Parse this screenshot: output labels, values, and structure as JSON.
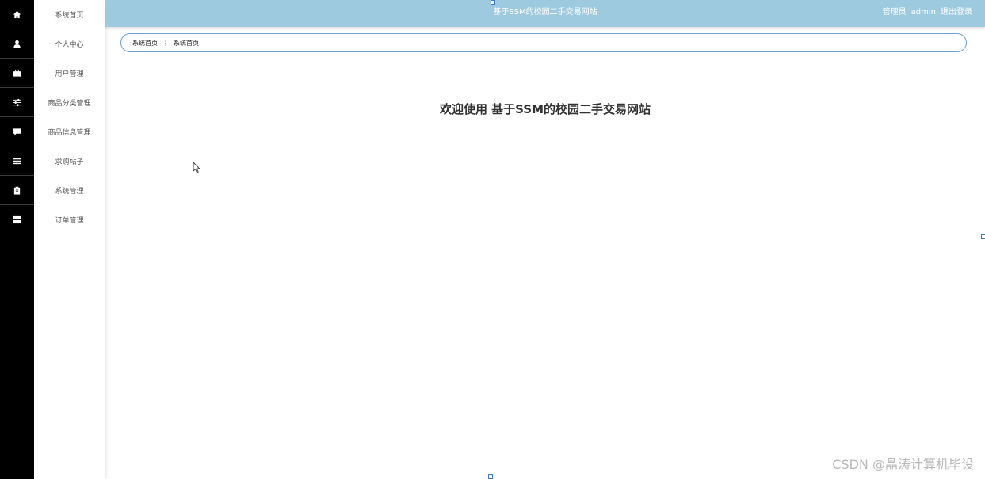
{
  "header": {
    "title": "基于SSM的校园二手交易网站",
    "user_role": "管理员",
    "username": "admin",
    "logout_label": "退出登录"
  },
  "rail_icons": [
    "home-icon",
    "user-icon",
    "briefcase-icon",
    "sliders-icon",
    "chat-icon",
    "list-icon",
    "clipboard-icon",
    "grid-icon"
  ],
  "menu": {
    "items": [
      {
        "label": "系统首页"
      },
      {
        "label": "个人中心"
      },
      {
        "label": "用户管理"
      },
      {
        "label": "商品分类管理"
      },
      {
        "label": "商品信息管理"
      },
      {
        "label": "求购帖子"
      },
      {
        "label": "系统管理"
      },
      {
        "label": "订单管理"
      }
    ]
  },
  "breadcrumb": {
    "items": [
      "系统首页",
      "系统首页"
    ]
  },
  "main": {
    "welcome": "欢迎使用 基于SSM的校园二手交易网站"
  },
  "watermark": "CSDN @晶涛计算机毕设",
  "colors": {
    "header_bg": "#9ecadf",
    "rail_bg": "#000000",
    "breadcrumb_border": "#6f9fd4"
  }
}
